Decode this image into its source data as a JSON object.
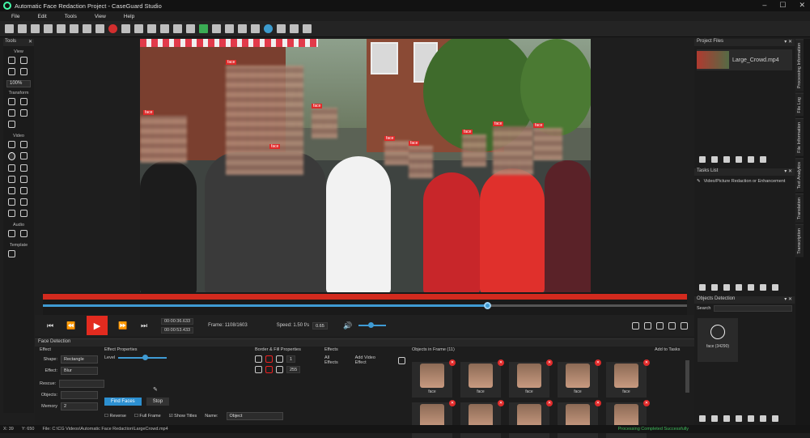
{
  "window": {
    "title": "Automatic Face Redaction Project - CaseGuard Studio"
  },
  "menu": [
    "File",
    "Edit",
    "Tools",
    "View",
    "Help"
  ],
  "tools": {
    "header": "Tools",
    "sections": [
      "View",
      "Transform",
      "Video",
      "Audio",
      "Template"
    ],
    "zoom": "100%"
  },
  "video": {
    "face_tags": [
      "face",
      "face",
      "face",
      "face",
      "face",
      "face",
      "face",
      "face",
      "face"
    ]
  },
  "transport": {
    "current_time": "00:00:36.633",
    "total_time": "00:00:53.433",
    "frame_label": "Frame: 1108/1603",
    "speed_label": "Speed: 1.50 f/s",
    "speed_value": "0.65"
  },
  "face_detection": {
    "header": "Face Detection",
    "effect_header": "Effect",
    "shape_label": "Shape:",
    "shape_value": "Rectangle",
    "effect_label": "Effect:",
    "effect_value": "Blur",
    "effect_props_header": "Effect Properties",
    "level_label": "Level",
    "border_header": "Border & Fill Properties",
    "border_value": "1",
    "fill_value": "255",
    "effects_header": "Effects",
    "all_effects": "All Effects",
    "add_video_effect": "Add Video Effect",
    "rescue_label": "Rescue:",
    "objects_label": "Objects:",
    "find_faces": "Find Faces",
    "stop": "Stop",
    "memory_label": "Memory",
    "memory_value": "2",
    "reverse": "Reverse",
    "full_frame": "Full Frame",
    "show_titles": "Show Titles",
    "name_label": "Name:",
    "name_value": "Object",
    "objects_in_frame": "Objects in Frame (11)",
    "add_to_tasks": "Add to Tasks",
    "thumb_labels": [
      "face",
      "face",
      "face",
      "face",
      "face",
      "",
      "",
      "",
      "",
      ""
    ]
  },
  "right_panel": {
    "project_files_header": "Project Files",
    "file_name": "Large_Crowd.mp4",
    "tasks_header": "Tasks List",
    "task_item": "Video/Picture Redaction or Enhancement",
    "objects_header": "Objects Detection",
    "search_label": "Search",
    "object_card_label": "face (34290)"
  },
  "side_tabs": [
    "Processing Information",
    "File Log",
    "File Information",
    "Text Analytics",
    "Translation",
    "Transcription"
  ],
  "status": {
    "x": "X: 39",
    "y": "Y: 650",
    "file": "File: C:\\CG Videos\\Automatic Face Redaction\\LargeCrowd.mp4",
    "message": "Processing Completed Successfully"
  },
  "colors": {
    "accent_red": "#e32b1f",
    "accent_blue": "#3f9bd4",
    "success_green": "#3dbb5a"
  }
}
